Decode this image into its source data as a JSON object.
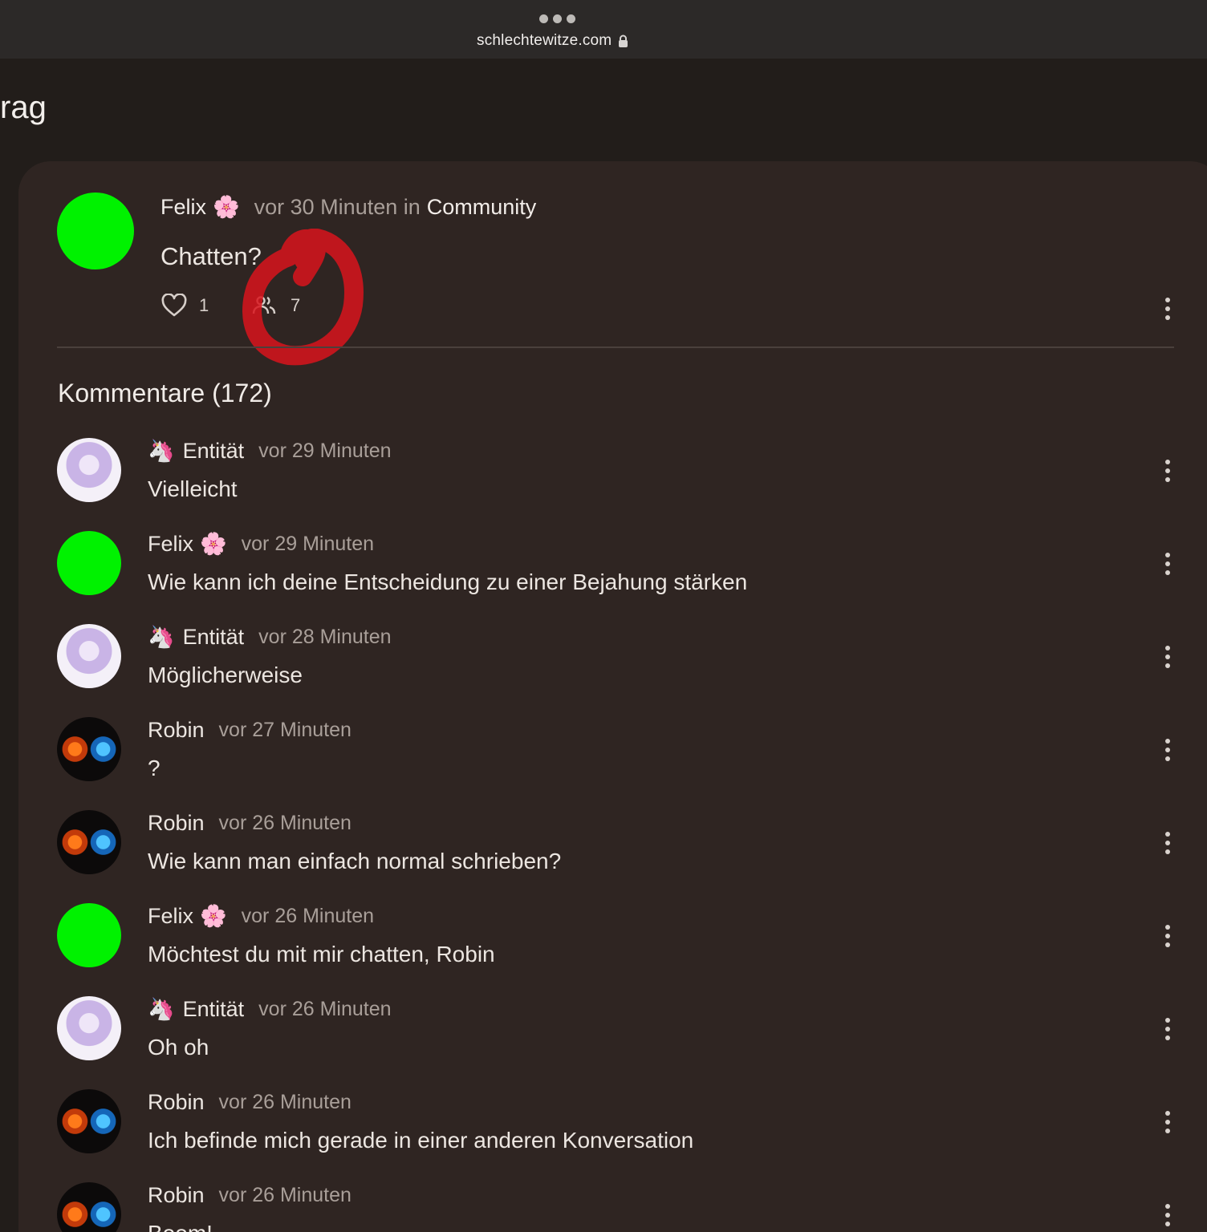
{
  "browser": {
    "url": "schlechtewitze.com"
  },
  "page": {
    "title": "rag"
  },
  "post": {
    "author": "Felix",
    "author_emoji": "🌸",
    "time": "vor 30 Minuten in",
    "community": "Community",
    "text": "Chatten?",
    "likes": "1",
    "participants": "7"
  },
  "comments_heading": "Kommentare (172)",
  "comments": [
    {
      "author": "Entität",
      "emoji_pre": "🦄",
      "emoji_post": "",
      "time": "vor 29 Minuten",
      "text": "Vielleicht",
      "avatar": "anime"
    },
    {
      "author": "Felix",
      "emoji_pre": "",
      "emoji_post": "🌸",
      "time": "vor 29 Minuten",
      "text": "Wie kann ich deine Entscheidung zu einer Bejahung stärken",
      "avatar": "green"
    },
    {
      "author": "Entität",
      "emoji_pre": "🦄",
      "emoji_post": "",
      "time": "vor 28 Minuten",
      "text": "Möglicherweise",
      "avatar": "anime"
    },
    {
      "author": "Robin",
      "emoji_pre": "",
      "emoji_post": "",
      "time": "vor 27 Minuten",
      "text": "?",
      "avatar": "fire"
    },
    {
      "author": "Robin",
      "emoji_pre": "",
      "emoji_post": "",
      "time": "vor 26 Minuten",
      "text": "Wie kann man einfach normal schrieben?",
      "avatar": "fire"
    },
    {
      "author": "Felix",
      "emoji_pre": "",
      "emoji_post": "🌸",
      "time": "vor 26 Minuten",
      "text": "Möchtest du mit mir chatten, Robin",
      "avatar": "green"
    },
    {
      "author": "Entität",
      "emoji_pre": "🦄",
      "emoji_post": "",
      "time": "vor 26 Minuten",
      "text": "Oh oh",
      "avatar": "anime"
    },
    {
      "author": "Robin",
      "emoji_pre": "",
      "emoji_post": "",
      "time": "vor 26 Minuten",
      "text": "Ich befinde mich gerade in einer anderen Konversation",
      "avatar": "fire"
    },
    {
      "author": "Robin",
      "emoji_pre": "",
      "emoji_post": "",
      "time": "vor 26 Minuten",
      "text": "Boom!",
      "avatar": "fire"
    }
  ],
  "icons": {
    "more": "more-vertical-icon",
    "like": "heart-icon",
    "participants": "people-icon",
    "lock": "lock-icon"
  },
  "colors": {
    "avatar_green": "#00f200",
    "annotation_red": "#d8141c",
    "card_background": "#2f2522"
  }
}
